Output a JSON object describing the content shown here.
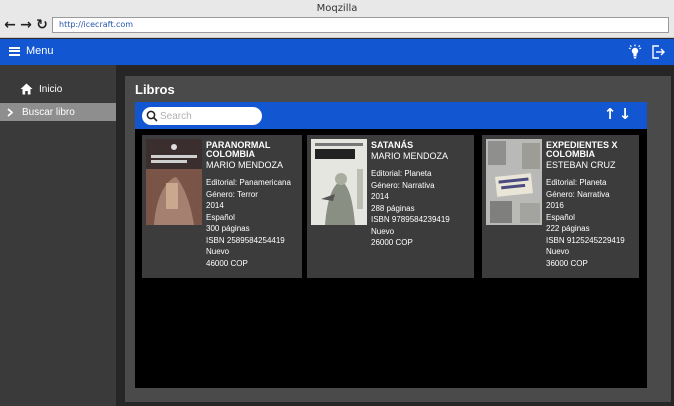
{
  "browser": {
    "window_title": "Moqzilla",
    "url": "http://icecraft.com",
    "back_glyph": "←",
    "forward_glyph": "→",
    "reload_glyph": "↻"
  },
  "appbar": {
    "menu_label": "Menu",
    "color": "#1256d1",
    "icons": [
      "lightbulb-icon",
      "logout-icon"
    ]
  },
  "sidebar": {
    "items": [
      {
        "label": "Inicio",
        "icon": "home-icon"
      },
      {
        "label": "Buscar libro",
        "icon": "chevron-right-icon",
        "selected": true
      }
    ]
  },
  "main": {
    "title": "Libros",
    "search": {
      "placeholder": "Search",
      "value": ""
    },
    "sort": {
      "asc_glyph": "↑",
      "desc_glyph": "↓"
    },
    "books": [
      {
        "title": "PARANORMAL COLOMBIA",
        "author": "MARIO MENDOZA",
        "editorial": "Editorial: Panamericana",
        "genre": "Género: Terror",
        "year": "2014",
        "language": "Español",
        "pages": "300 páginas",
        "isbn": "ISBN 2589584254419",
        "condition": "Nuevo",
        "price": "46000 COP",
        "cover_title": "PARANORMAL COLOMBIA"
      },
      {
        "title": "SATANÁS",
        "author": "MARIO MENDOZA",
        "editorial": "Editorial: Planeta",
        "genre": "Género: Narrativa",
        "year": "2014",
        "pages": "288 páginas",
        "isbn": "ISBN 9789584239419",
        "condition": "Nuevo",
        "price": "26000 COP",
        "cover_title": "SATANÁS"
      },
      {
        "title": "EXPEDIENTES X COLOMBIA",
        "author": "ESTEBAN CRUZ",
        "editorial": "Editorial: Planeta",
        "genre": "Género: Narrativa",
        "year": "2016",
        "language": "Español",
        "pages": "222 páginas",
        "isbn": "ISBN 9125245229419",
        "condition": "Nuevo",
        "price": "36000 COP",
        "cover_title": "EXPEDIENTES X COLOMBIA"
      }
    ]
  }
}
